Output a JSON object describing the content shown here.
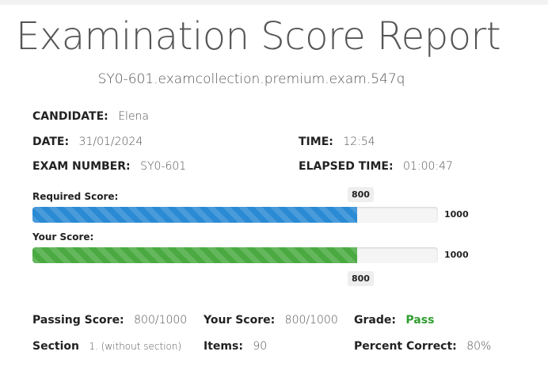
{
  "report": {
    "title": "Examination Score Report",
    "exam_file": "SY0-601.examcollection.premium.exam.547q"
  },
  "candidate": {
    "label": "CANDIDATE:",
    "value": "Elena"
  },
  "date": {
    "label": "DATE:",
    "value": "31/01/2024"
  },
  "time": {
    "label": "TIME:",
    "value": "12:54"
  },
  "exam_number": {
    "label": "EXAM NUMBER:",
    "value": "SY0-601"
  },
  "elapsed_time": {
    "label": "ELAPSED TIME:",
    "value": "01:00:47"
  },
  "bars": {
    "required": {
      "label": "Required Score:",
      "score": "800",
      "max": "1000",
      "fraction": 0.8,
      "color": "#2a8ad4"
    },
    "yours": {
      "label": "Your Score:",
      "score": "800",
      "max": "1000",
      "fraction": 0.8,
      "color": "#4aaa41"
    }
  },
  "summary": {
    "passing_score": {
      "label": "Passing Score:",
      "value": "800/1000"
    },
    "your_score": {
      "label": "Your Score:",
      "value": "800/1000"
    },
    "grade": {
      "label": "Grade:",
      "value": "Pass",
      "color": "#2e9e2e"
    },
    "section": {
      "label": "Section",
      "value": "1. (without section)"
    },
    "items": {
      "label": "Items:",
      "value": "90"
    },
    "percent_correct": {
      "label": "Percent Correct:",
      "value": "80%"
    }
  }
}
